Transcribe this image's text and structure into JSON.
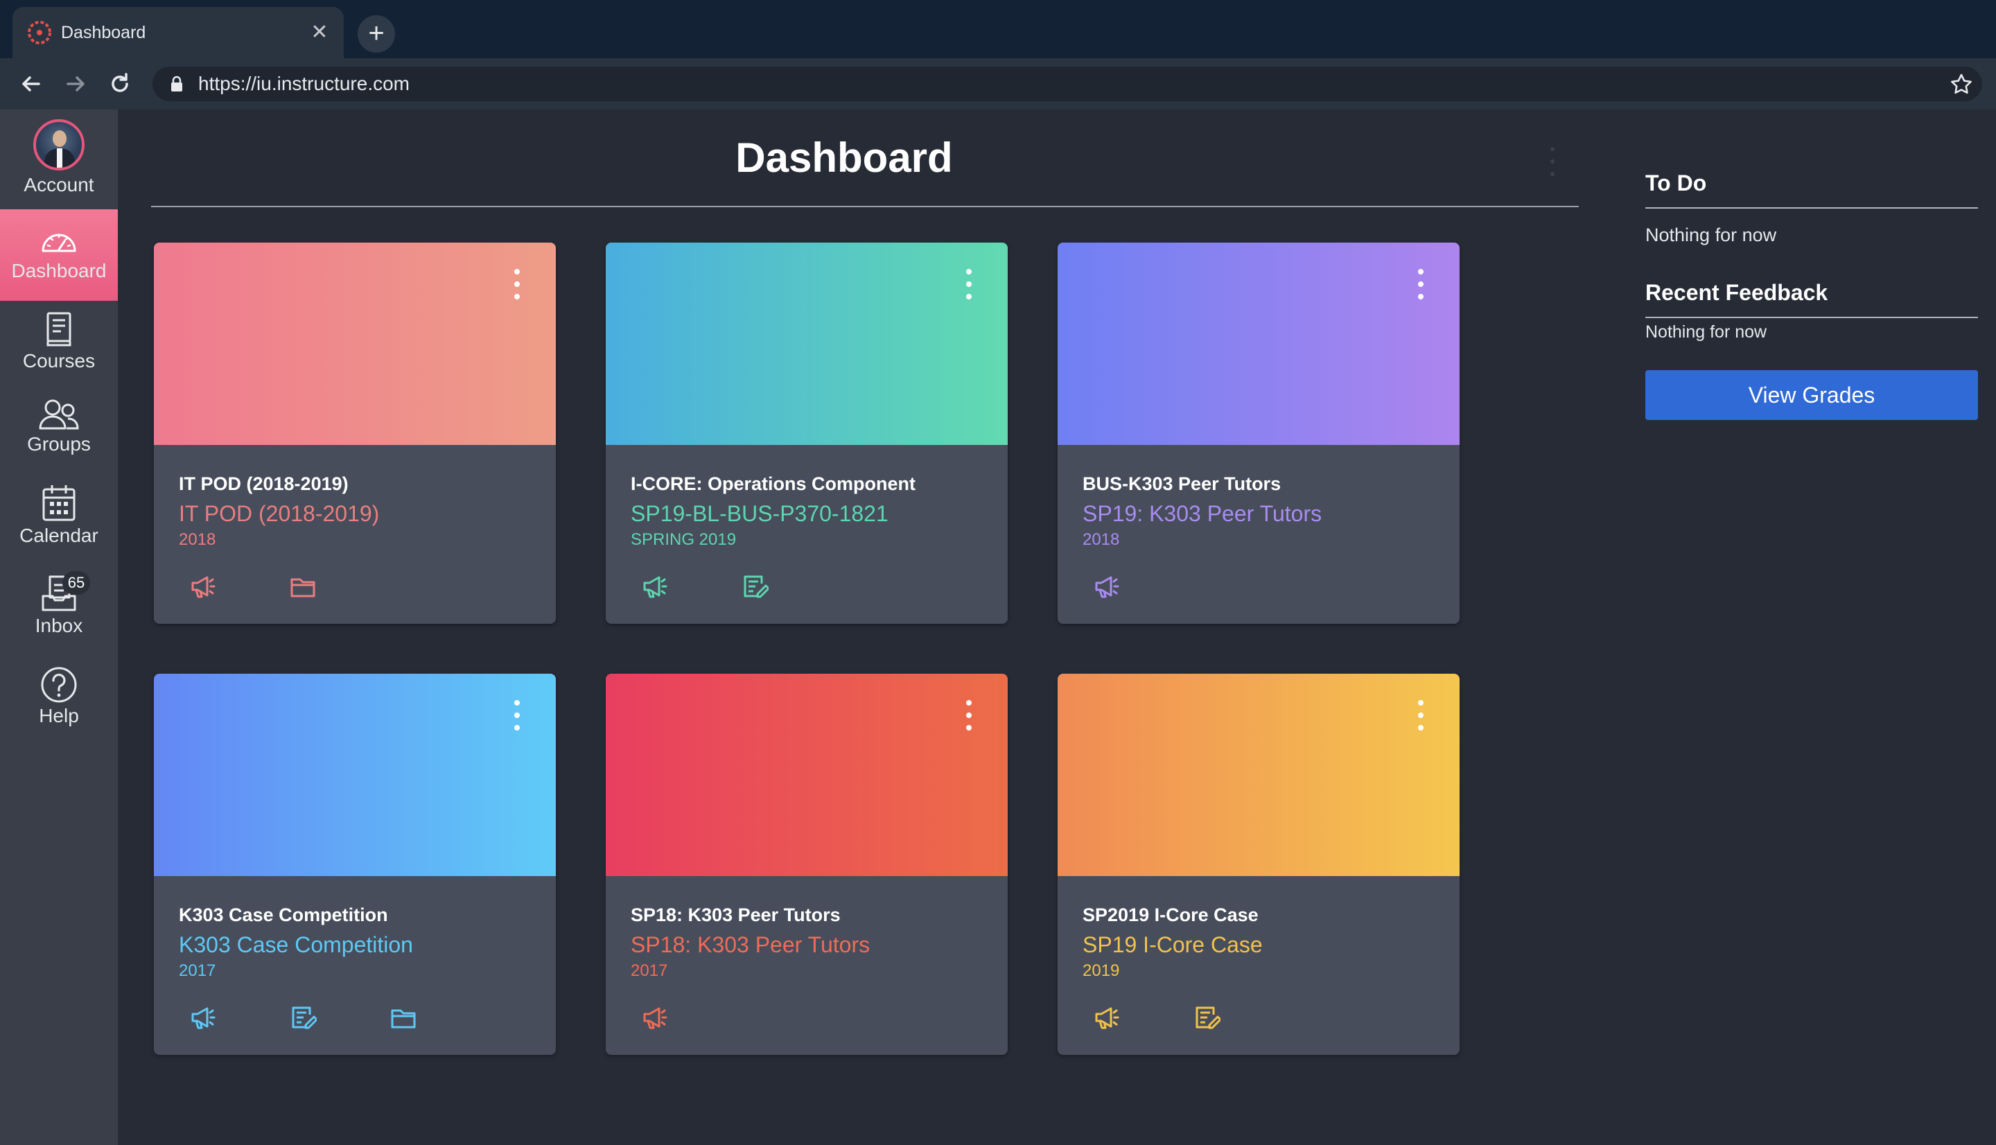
{
  "browser": {
    "tab_title": "Dashboard",
    "tab_close": "✕",
    "new_tab": "+",
    "url": "https://iu.instructure.com"
  },
  "nav": {
    "account": "Account",
    "dashboard": "Dashboard",
    "courses": "Courses",
    "groups": "Groups",
    "calendar": "Calendar",
    "inbox": "Inbox",
    "inbox_badge": "65",
    "help": "Help"
  },
  "main": {
    "title": "Dashboard"
  },
  "cards": [
    {
      "name": "IT POD (2018-2019)",
      "code": "IT POD (2018-2019)",
      "term": "2018",
      "color": "#e97e80",
      "gradient": [
        "#ef7a8f",
        "#ee9d88"
      ],
      "icons": [
        "announcements-icon",
        "files-icon"
      ]
    },
    {
      "name": "I-CORE: Operations Component",
      "code": "SP19-BL-BUS-P370-1821",
      "term": "SPRING 2019",
      "color": "#5dd6b0",
      "gradient": [
        "#4aaedf",
        "#62dab0"
      ],
      "icons": [
        "announcements-icon",
        "assignments-icon"
      ]
    },
    {
      "name": "BUS-K303 Peer Tutors",
      "code": "SP19: K303 Peer Tutors",
      "term": "2018",
      "color": "#a98cf0",
      "gradient": [
        "#6f80f2",
        "#ad85ee"
      ],
      "icons": [
        "announcements-icon"
      ]
    },
    {
      "name": "K303 Case Competition",
      "code": "K303 Case Competition",
      "term": "2017",
      "color": "#5ec9f5",
      "gradient": [
        "#6487f5",
        "#5fcbf7"
      ],
      "icons": [
        "announcements-icon",
        "assignments-icon",
        "files-icon"
      ]
    },
    {
      "name": "SP18: K303 Peer Tutors",
      "code": "SP18: K303 Peer Tutors",
      "term": "2017",
      "color": "#ef6c56",
      "gradient": [
        "#e83e60",
        "#ed6d48"
      ],
      "icons": [
        "announcements-icon"
      ]
    },
    {
      "name": "SP2019 I-Core Case",
      "code": "SP19 I-Core Case",
      "term": "2019",
      "color": "#f2c24c",
      "gradient": [
        "#f08b55",
        "#f5c74f"
      ],
      "icons": [
        "announcements-icon",
        "assignments-icon"
      ]
    }
  ],
  "sidebar": {
    "todo_title": "To Do",
    "todo_empty": "Nothing for now",
    "feedback_title": "Recent Feedback",
    "feedback_empty": "Nothing for now",
    "view_grades": "View Grades"
  }
}
